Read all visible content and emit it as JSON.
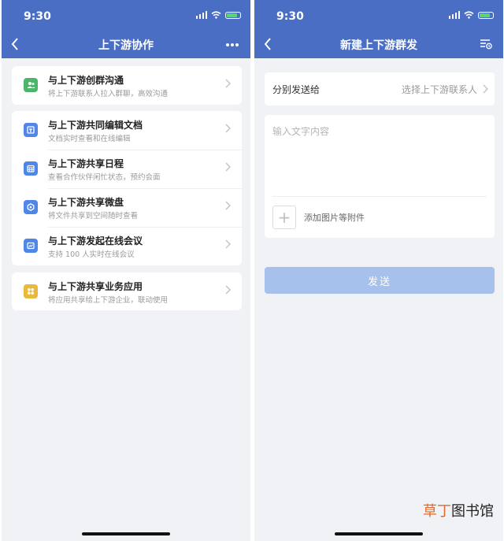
{
  "left": {
    "status_time": "9:30",
    "title": "上下游协作",
    "more_label": "•••",
    "groups": [
      {
        "items": [
          {
            "title": "与上下游创群沟通",
            "subtitle": "将上下游联系人拉入群聊，高效沟通",
            "icon": "group-chat-icon",
            "icon_color": "#4db56a"
          }
        ]
      },
      {
        "items": [
          {
            "title": "与上下游共同编辑文档",
            "subtitle": "文档实时查看和在线编辑",
            "icon": "document-icon",
            "icon_color": "#4f86e8"
          },
          {
            "title": "与上下游共享日程",
            "subtitle": "查看合作伙伴闲忙状态，预约会面",
            "icon": "calendar-icon",
            "icon_color": "#4f86e8"
          },
          {
            "title": "与上下游共享微盘",
            "subtitle": "将文件共享到空间随时查看",
            "icon": "drive-icon",
            "icon_color": "#4f86e8"
          },
          {
            "title": "与上下游发起在线会议",
            "subtitle": "支持 100 人实时在线会议",
            "icon": "meeting-icon",
            "icon_color": "#4f86e8"
          }
        ]
      },
      {
        "items": [
          {
            "title": "与上下游共享业务应用",
            "subtitle": "将应用共享给上下游企业，联动使用",
            "icon": "apps-icon",
            "icon_color": "#eab83a"
          }
        ]
      }
    ]
  },
  "right": {
    "status_time": "9:30",
    "title": "新建上下游群发",
    "send_to_label": "分别发送给",
    "send_to_value": "选择上下游联系人",
    "text_placeholder": "输入文字内容",
    "attach_plus": "+",
    "attach_label": "添加图片等附件",
    "send_button": "发送"
  },
  "watermark": {
    "part1": "草丁",
    "part2": "图书馆"
  },
  "colors": {
    "header": "#4a6ec4",
    "send_button": "#a6c1ec",
    "background": "#f1f2f6"
  }
}
